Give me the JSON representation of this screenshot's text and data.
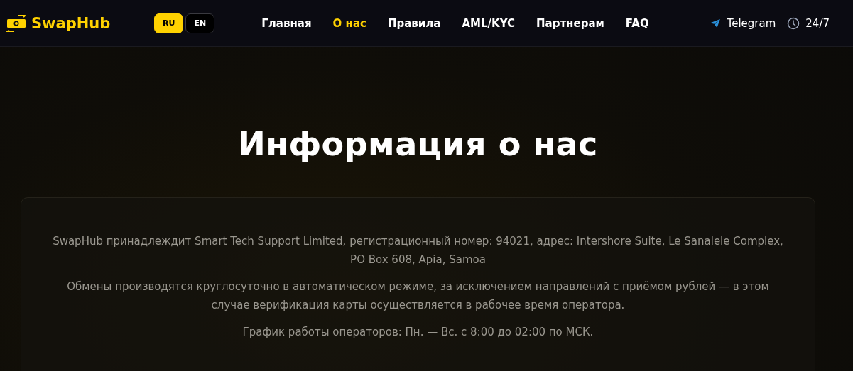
{
  "header": {
    "logo": "SwapHub",
    "languages": [
      {
        "label": "RU",
        "selected": true
      },
      {
        "label": "EN",
        "selected": false
      }
    ],
    "nav": [
      {
        "label": "Главная",
        "selected": false
      },
      {
        "label": "О нас",
        "selected": true
      },
      {
        "label": "Правила",
        "selected": false
      },
      {
        "label": "AML/KYC",
        "selected": false
      },
      {
        "label": "Партнерам",
        "selected": false
      },
      {
        "label": "FAQ",
        "selected": false
      }
    ],
    "telegram": "Telegram",
    "hours": "24/7"
  },
  "page": {
    "title": "Информация о нас",
    "paragraphs": [
      "SwapHub принадлеждит Smart Tech Support Limited, регистрационный номер: 94021, адрес: Intershore Suite, Le Sanalele Complex, PO Box 608, Apia, Samoa",
      "Обмены производятся круглосуточно в автоматическом режиме, за исключением направлений с приёмом рублей — в этом случае верификация карты осуществляется в рабочее время оператора.",
      "График работы операторов: Пн. — Вс. с 8:00 до 02:00 по МСК."
    ]
  }
}
